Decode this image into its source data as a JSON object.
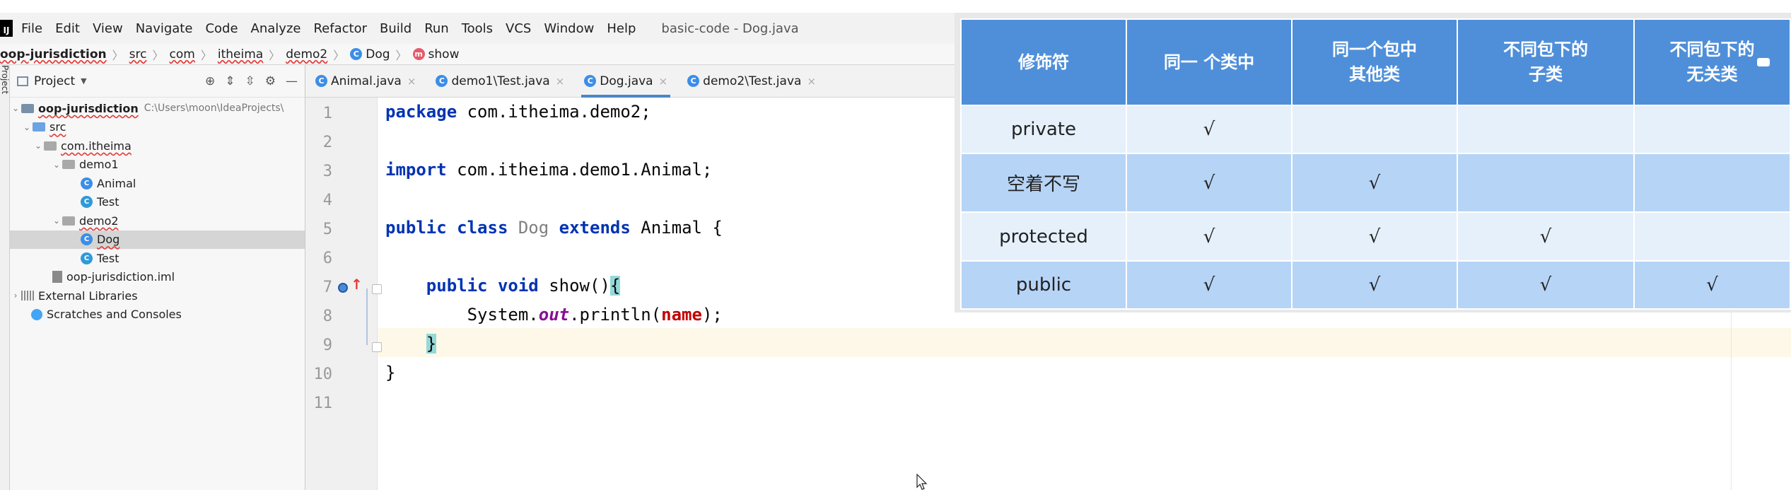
{
  "menubar": {
    "logo": "IJ",
    "items": [
      "File",
      "Edit",
      "View",
      "Navigate",
      "Code",
      "Analyze",
      "Refactor",
      "Build",
      "Run",
      "Tools",
      "VCS",
      "Window",
      "Help"
    ],
    "window_title": "basic-code - Dog.java"
  },
  "breadcrumb": {
    "items": [
      "oop-jurisdiction",
      "src",
      "com",
      "itheima",
      "demo2",
      "Dog",
      "show"
    ]
  },
  "left_stripe": {
    "label": "Project"
  },
  "project_panel": {
    "title": "Project",
    "tree": [
      {
        "label": "oop-jurisdiction",
        "path": "C:\\Users\\moon\\IdeaProjects\\"
      },
      {
        "label": "src"
      },
      {
        "label": "com.itheima"
      },
      {
        "label": "demo1"
      },
      {
        "label": "Animal"
      },
      {
        "label": "Test"
      },
      {
        "label": "demo2"
      },
      {
        "label": "Dog"
      },
      {
        "label": "Test"
      },
      {
        "label": "oop-jurisdiction.iml"
      },
      {
        "label": "External Libraries"
      },
      {
        "label": "Scratches and Consoles"
      }
    ]
  },
  "tabs": [
    {
      "label": "Animal.java"
    },
    {
      "label": "demo1\\Test.java"
    },
    {
      "label": "Dog.java",
      "active": true
    },
    {
      "label": "demo2\\Test.java"
    }
  ],
  "editor": {
    "line_numbers": [
      "1",
      "2",
      "3",
      "4",
      "5",
      "6",
      "7",
      "8",
      "9",
      "10",
      "11"
    ],
    "lines": {
      "l1": {
        "kw": "package",
        "rest": " com.itheima.demo2;"
      },
      "l3": {
        "kw": "import",
        "rest": " com.itheima.demo1.Animal;"
      },
      "l5": {
        "kw1": "public class",
        "cls": "Dog",
        "kw2": "extends",
        "rest": "Animal {"
      },
      "l7": {
        "kw": "public void",
        "rest": "show()",
        "brace": "{"
      },
      "l8": {
        "pre": "System.",
        "static": "out",
        "mid": ".println(",
        "field": "name",
        "post": ");"
      },
      "l9": {
        "brace": "}"
      },
      "l10": {
        "text": "}"
      }
    }
  },
  "overlay_table": {
    "headers": [
      "修饰符",
      "同一 个类中",
      "同一个包中\n其他类",
      "不同包下的\n子类",
      "不同包下的\n无关类"
    ],
    "rows": [
      {
        "label": "private",
        "cells": [
          "√",
          "",
          "",
          ""
        ]
      },
      {
        "label": "空着不写",
        "cells": [
          "√",
          "√",
          "",
          ""
        ]
      },
      {
        "label": "protected",
        "cells": [
          "√",
          "√",
          "√",
          ""
        ]
      },
      {
        "label": "public",
        "cells": [
          "√",
          "√",
          "√",
          "√"
        ]
      }
    ]
  },
  "colors": {
    "table_header": "#4f8fd9",
    "row_light": "#e6f0fb",
    "row_dark": "#b6d4f6",
    "keyword": "#0033b3",
    "field": "#c20000"
  }
}
